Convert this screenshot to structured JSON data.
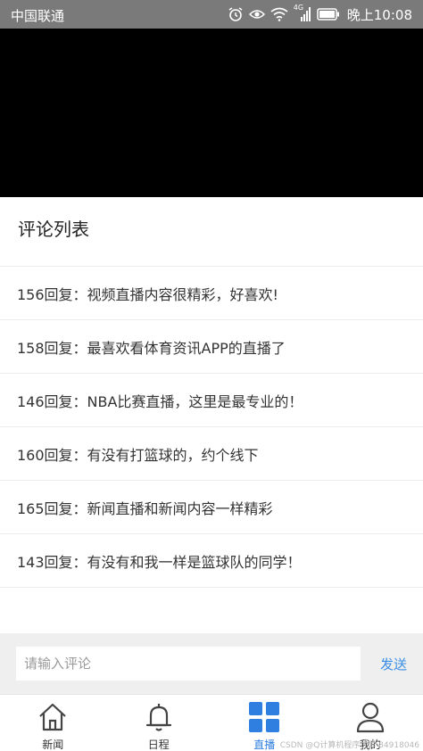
{
  "status_bar": {
    "carrier": "中国联通",
    "network": "4G",
    "time": "晚上10:08"
  },
  "comments": {
    "title": "评论列表",
    "items": [
      "156回复：视频直播内容很精彩，好喜欢!",
      "158回复：最喜欢看体育资讯APP的直播了",
      "146回复：NBA比赛直播，这里是最专业的！",
      "160回复：有没有打篮球的，约个线下",
      "165回复：新闻直播和新闻内容一样精彩",
      "143回复：有没有和我一样是篮球队的同学！"
    ]
  },
  "input_bar": {
    "placeholder": "请输入评论",
    "value": "",
    "send_label": "发送"
  },
  "tab_bar": {
    "tabs": [
      {
        "label": "新闻",
        "icon": "home-icon",
        "active": false
      },
      {
        "label": "日程",
        "icon": "bell-icon",
        "active": false
      },
      {
        "label": "直播",
        "icon": "grid-icon",
        "active": true
      },
      {
        "label": "我的",
        "icon": "user-icon",
        "active": false
      }
    ]
  },
  "watermark": "CSDN @Q计算机程序优异  84918046",
  "colors": {
    "accent": "#2f7fe0",
    "send": "#3a8ee6",
    "status_bar": "#7a7a7a",
    "video": "#000000",
    "input_bar_bg": "#efefef"
  }
}
